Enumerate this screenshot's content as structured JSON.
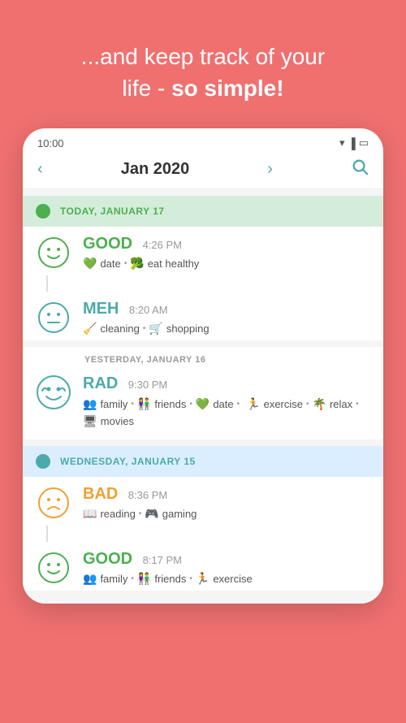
{
  "header": {
    "line1": "...and keep track of your",
    "line2": "life - ",
    "line2_bold": "so simple!"
  },
  "status_bar": {
    "time": "10:00"
  },
  "nav": {
    "month": "Jan 2020",
    "prev_label": "‹",
    "next_label": "›"
  },
  "days": [
    {
      "id": "today",
      "type": "today",
      "label": "TODAY, JANUARY 17",
      "dot_color": "green",
      "label_color": "green",
      "entries": [
        {
          "mood": "GOOD",
          "mood_color": "good",
          "time": "4:26 PM",
          "tags": [
            {
              "icon": "💚",
              "label": "date"
            },
            {
              "icon": "🥦",
              "label": "eat healthy"
            }
          ]
        },
        {
          "mood": "MEH",
          "mood_color": "meh",
          "time": "8:20 AM",
          "tags": [
            {
              "icon": "🧹",
              "label": "cleaning"
            },
            {
              "icon": "🛒",
              "label": "shopping"
            }
          ]
        }
      ]
    },
    {
      "id": "yesterday",
      "type": "yesterday",
      "label": "YESTERDAY, JANUARY 16",
      "entries": [
        {
          "mood": "RAD",
          "mood_color": "rad",
          "time": "9:30 PM",
          "tags": [
            {
              "icon": "👥",
              "label": "family"
            },
            {
              "icon": "👫",
              "label": "friends"
            },
            {
              "icon": "💚",
              "label": "date"
            },
            {
              "icon": "🏃",
              "label": "exercise"
            },
            {
              "icon": "🌴",
              "label": "relax"
            },
            {
              "icon": "🖥",
              "label": "movies"
            }
          ]
        }
      ]
    },
    {
      "id": "wednesday",
      "type": "wednesday",
      "label": "WEDNESDAY, JANUARY 15",
      "dot_color": "blue",
      "label_color": "teal",
      "entries": [
        {
          "mood": "BAD",
          "mood_color": "bad",
          "time": "8:36 PM",
          "tags": [
            {
              "icon": "📖",
              "label": "reading"
            },
            {
              "icon": "🎮",
              "label": "gaming"
            }
          ]
        },
        {
          "mood": "GOOD",
          "mood_color": "good",
          "time": "8:17 PM",
          "tags": [
            {
              "icon": "👥",
              "label": "family"
            },
            {
              "icon": "👫",
              "label": "friends"
            },
            {
              "icon": "🏃",
              "label": "exercise"
            }
          ]
        }
      ]
    }
  ],
  "icons": {
    "search": "🔍",
    "prev_arrow": "‹",
    "next_arrow": "›"
  }
}
